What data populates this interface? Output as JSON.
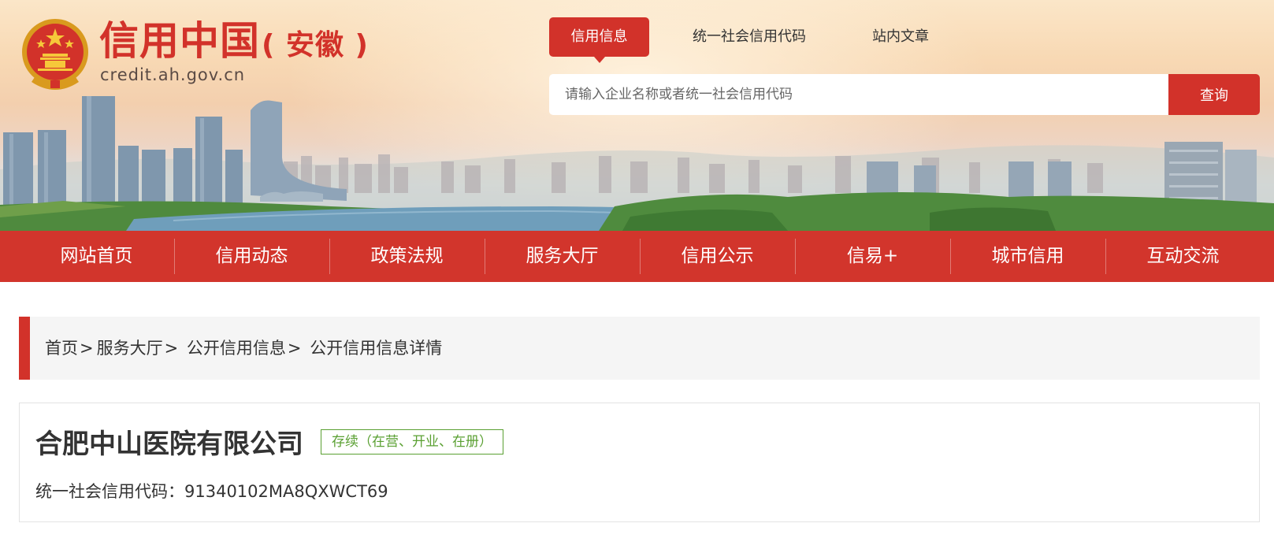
{
  "header": {
    "site_title": "信用中国",
    "site_region": "( 安徽 )",
    "domain": "credit.ah.gov.cn",
    "emblem_icon": "national-emblem-icon"
  },
  "search_tabs": [
    {
      "label": "信用信息",
      "active": true
    },
    {
      "label": "统一社会信用代码",
      "active": false
    },
    {
      "label": "站内文章",
      "active": false
    }
  ],
  "search": {
    "value": "",
    "placeholder": "请输入企业名称或者统一社会信用代码",
    "button_label": "查询"
  },
  "nav": {
    "items": [
      "网站首页",
      "信用动态",
      "政策法规",
      "服务大厅",
      "信用公示",
      "信易+",
      "城市信用",
      "互动交流"
    ]
  },
  "breadcrumb": {
    "items": [
      "首页",
      "服务大厅",
      "公开信用信息",
      "公开信用信息详情"
    ],
    "separator": ">"
  },
  "company": {
    "name": "合肥中山医院有限公司",
    "status": "存续（在营、开业、在册）",
    "code_label": "统一社会信用代码：",
    "code_value": "91340102MA8QXWCT69"
  },
  "colors": {
    "brand_red": "#d2322a",
    "status_green": "#5aa032",
    "breadcrumb_bg": "#f5f5f5"
  }
}
